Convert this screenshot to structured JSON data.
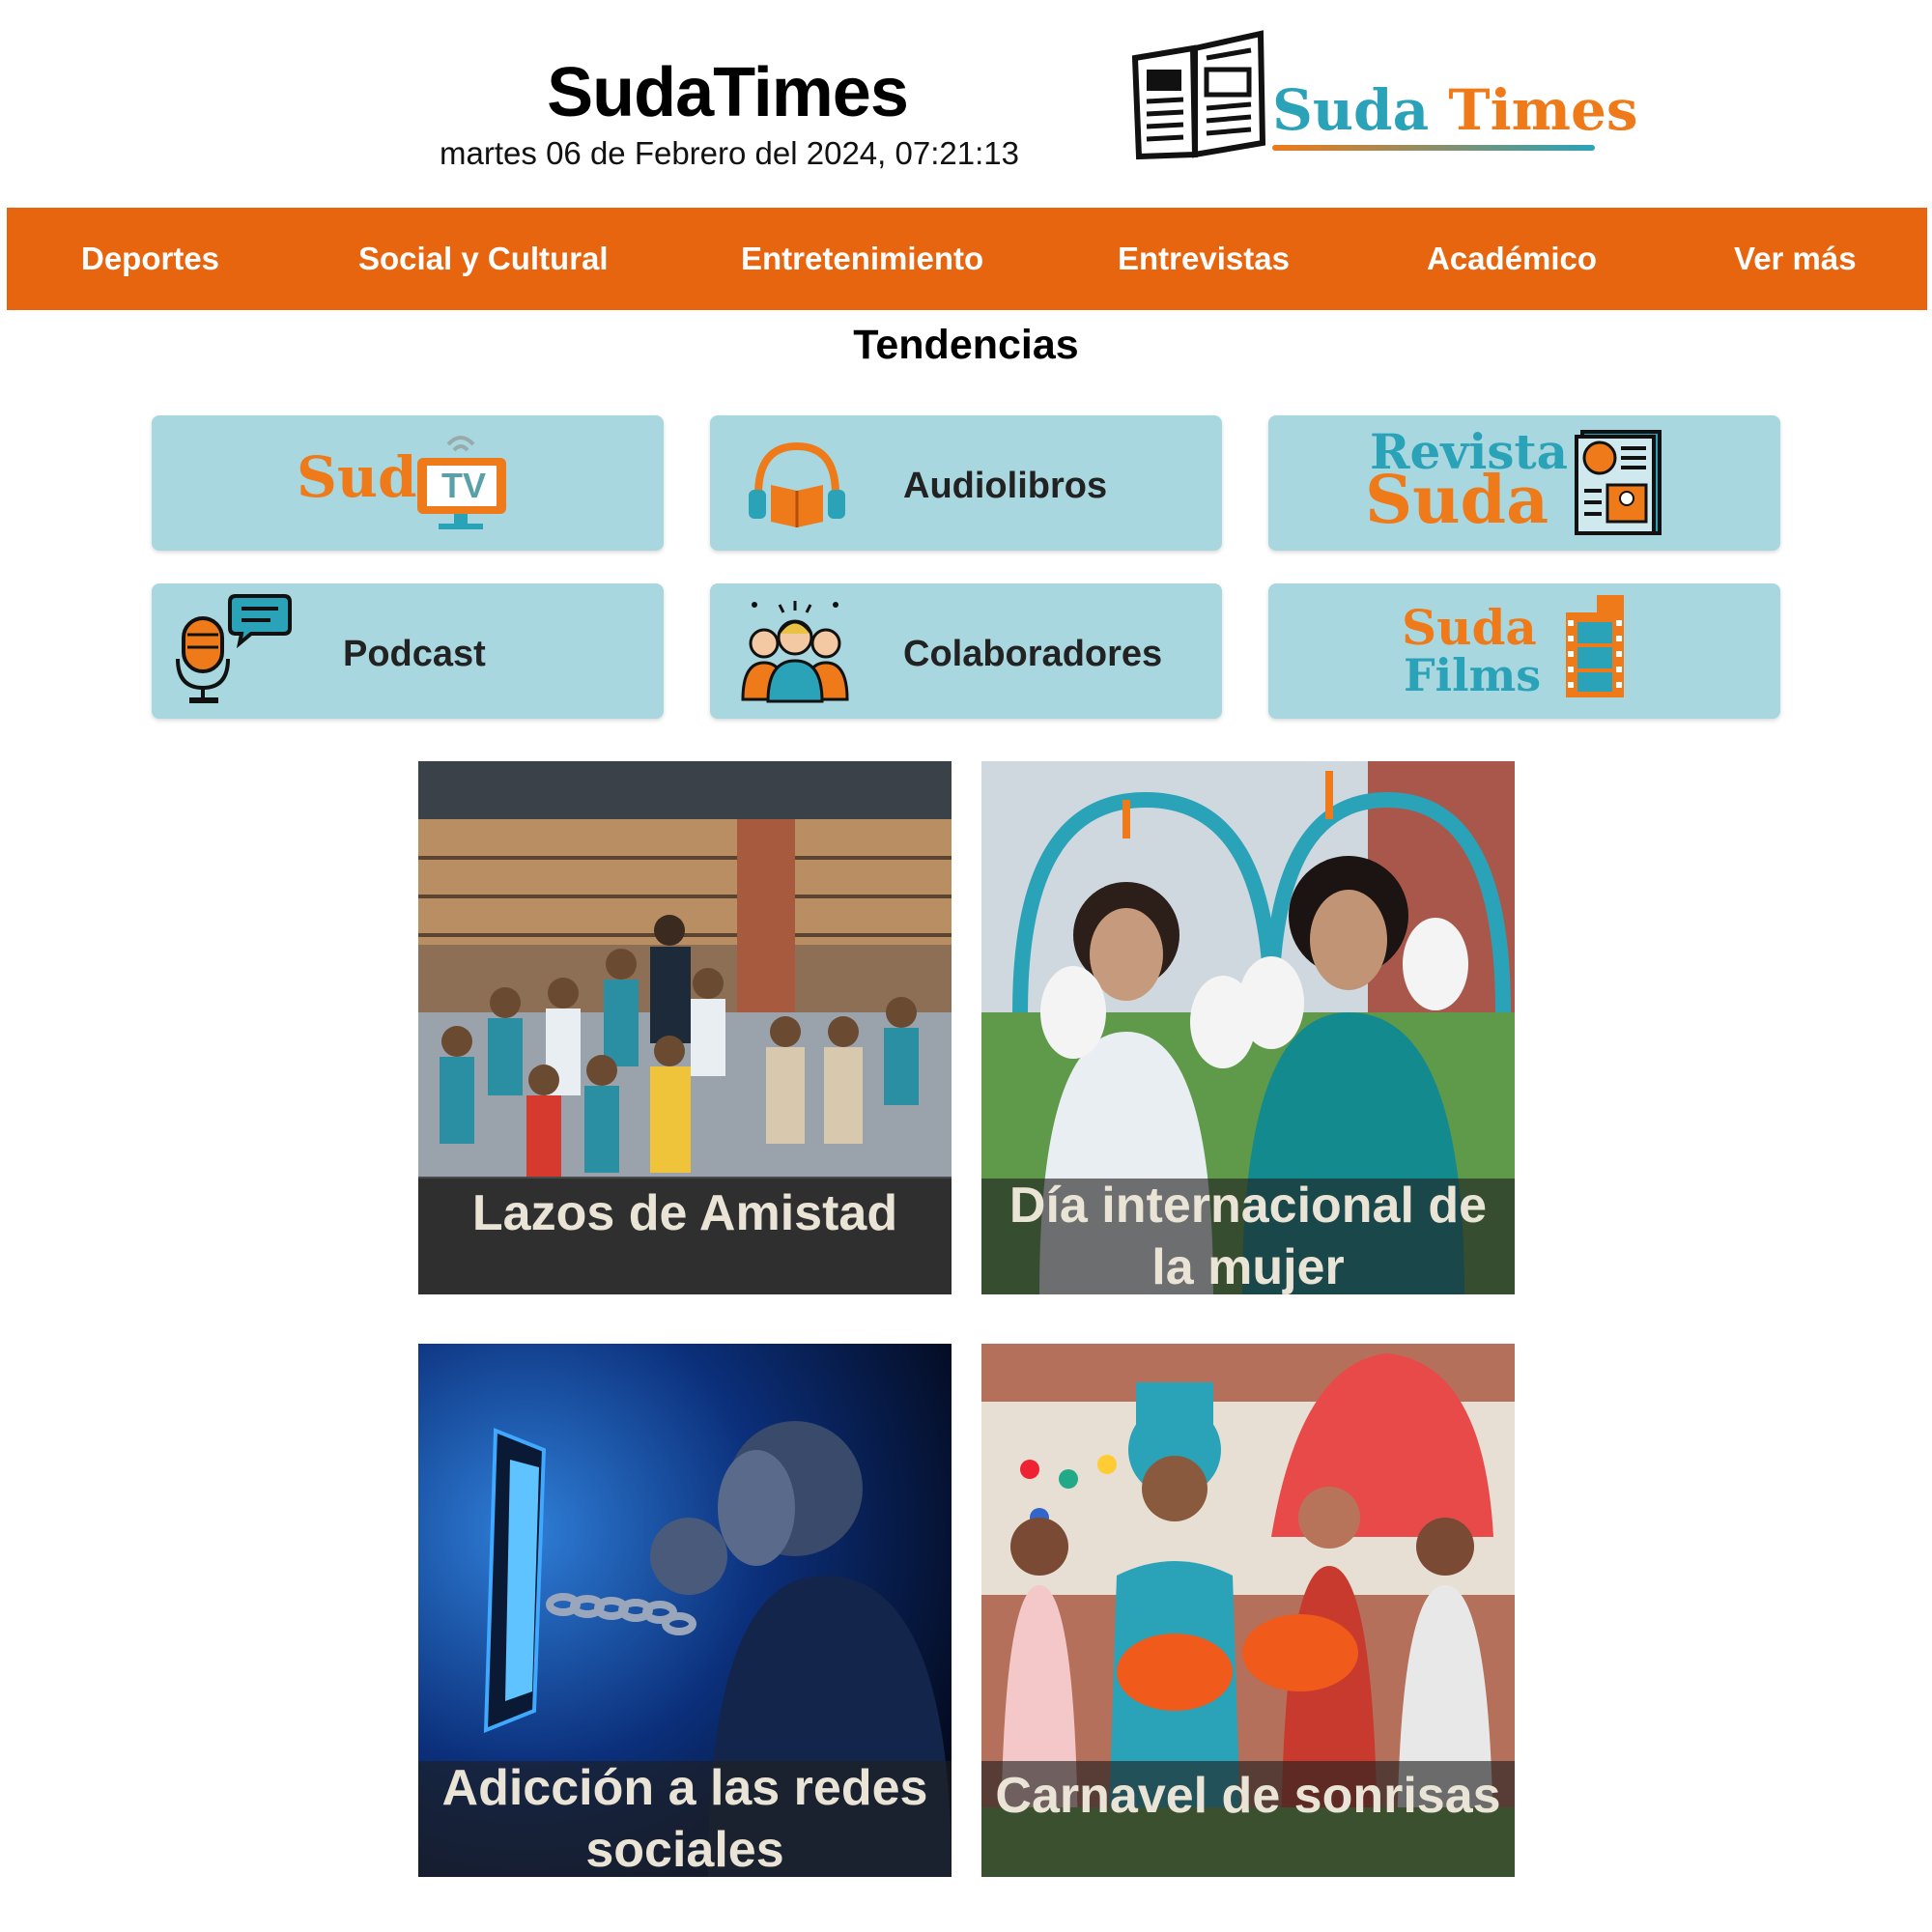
{
  "header": {
    "title": "SudaTimes",
    "datetime": "martes 06 de Febrero del 2024, 07:21:13",
    "logo_word1": "Suda",
    "logo_word2": "Times"
  },
  "nav": {
    "items": [
      {
        "label": "Deportes"
      },
      {
        "label": "Social y Cultural"
      },
      {
        "label": "Entretenimiento"
      },
      {
        "label": "Entrevistas"
      },
      {
        "label": "Académico"
      },
      {
        "label": "Ver más"
      }
    ]
  },
  "trends": {
    "title": "Tendencias",
    "cards": [
      {
        "brand": "Suda",
        "brand2": "TV"
      },
      {
        "label": "Audiolibros"
      },
      {
        "brand": "Revista",
        "brand2": "Suda"
      },
      {
        "label": "Podcast"
      },
      {
        "label": "Colaboradores"
      },
      {
        "brand": "Suda",
        "brand2": "Films"
      }
    ]
  },
  "news": [
    {
      "title": "Lazos de Amistad"
    },
    {
      "title": "Día internacional de la mujer"
    },
    {
      "title": "Adicción a las redes sociales"
    },
    {
      "title": "Carnavel de sonrisas"
    }
  ],
  "colors": {
    "nav_bg": "#e8650f",
    "card_bg": "#a8d7df",
    "brand_orange": "#ee7a1a",
    "brand_teal": "#2aa3b8"
  }
}
